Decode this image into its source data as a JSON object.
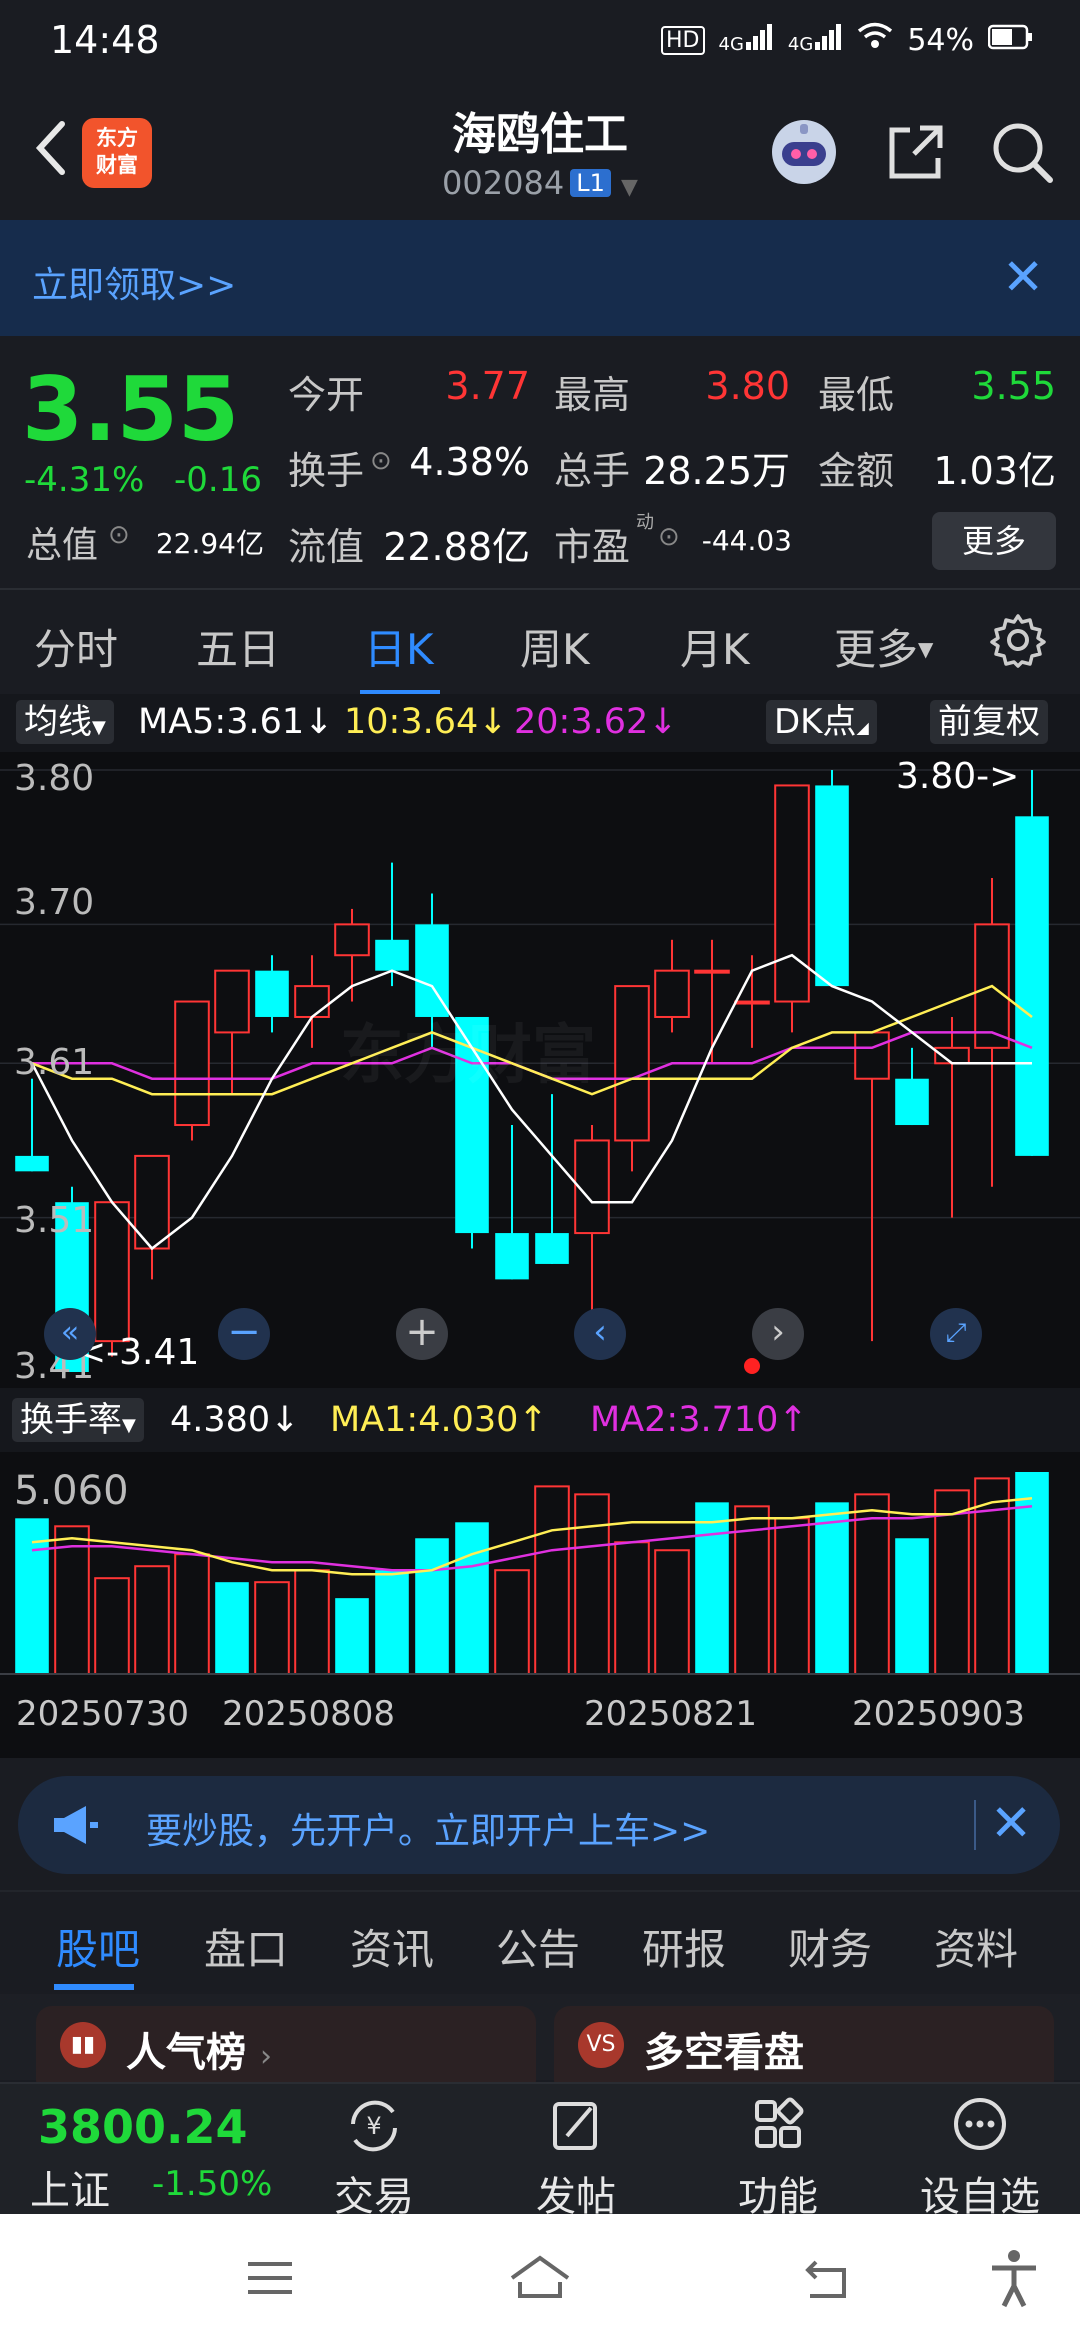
{
  "status": {
    "time": "14:48",
    "hd": "HD",
    "sig1": "4G",
    "sig2": "4G",
    "battery": "54%"
  },
  "header": {
    "logo_line1": "东方",
    "logo_line2": "财富",
    "stock_name": "海鸥住工",
    "stock_code": "002084",
    "level": "L1"
  },
  "banner": {
    "text": "立即领取>>"
  },
  "quote": {
    "price": "3.55",
    "change_pct": "-4.31%",
    "change": "-0.16",
    "open_label": "今开",
    "open": "3.77",
    "high_label": "最高",
    "high": "3.80",
    "low_label": "最低",
    "low": "3.55",
    "turnover_label": "换手",
    "turnover": "4.38%",
    "volume_label": "总手",
    "volume": "28.25万",
    "amount_label": "金额",
    "amount": "1.03亿",
    "mcap_label": "总值",
    "mcap": "22.94亿",
    "float_label": "流值",
    "float": "22.88亿",
    "pe_label": "市盈",
    "pe_tag": "动",
    "pe": "-44.03",
    "more": "更多"
  },
  "ktabs": [
    "分时",
    "五日",
    "日K",
    "周K",
    "月K",
    "更多"
  ],
  "indicators": {
    "ma_label": "均线",
    "ma5": "MA5:3.61↓",
    "ma10": "10:3.64↓",
    "ma20": "20:3.62↓",
    "dk": "DK点",
    "fq": "前复权"
  },
  "kchart": {
    "y_labels": [
      "3.80",
      "3.70",
      "3.61",
      "3.51",
      "3.41"
    ],
    "max_note": "3.80->",
    "min_note": "<-3.41",
    "watermark": "东方财富"
  },
  "vol": {
    "label": "换手率",
    "value": "4.380↓",
    "ma1": "MA1:4.030↑",
    "ma2": "MA2:3.710↑",
    "y_label": "5.060",
    "dates": [
      "20250730",
      "20250808",
      "20250821",
      "20250903"
    ]
  },
  "chart_data": {
    "type": "candlestick",
    "ylim": [
      3.41,
      3.8
    ],
    "candles": [
      {
        "o": 3.55,
        "h": 3.6,
        "l": 3.54,
        "c": 3.54
      },
      {
        "o": 3.52,
        "h": 3.53,
        "l": 3.41,
        "c": 3.41
      },
      {
        "o": 3.43,
        "h": 3.52,
        "l": 3.42,
        "c": 3.52
      },
      {
        "o": 3.49,
        "h": 3.55,
        "l": 3.47,
        "c": 3.55
      },
      {
        "o": 3.57,
        "h": 3.65,
        "l": 3.56,
        "c": 3.65
      },
      {
        "o": 3.63,
        "h": 3.67,
        "l": 3.59,
        "c": 3.67
      },
      {
        "o": 3.67,
        "h": 3.68,
        "l": 3.63,
        "c": 3.64
      },
      {
        "o": 3.64,
        "h": 3.68,
        "l": 3.62,
        "c": 3.66
      },
      {
        "o": 3.68,
        "h": 3.71,
        "l": 3.65,
        "c": 3.7
      },
      {
        "o": 3.69,
        "h": 3.74,
        "l": 3.66,
        "c": 3.67
      },
      {
        "o": 3.7,
        "h": 3.72,
        "l": 3.62,
        "c": 3.64
      },
      {
        "o": 3.64,
        "h": 3.64,
        "l": 3.49,
        "c": 3.5
      },
      {
        "o": 3.5,
        "h": 3.57,
        "l": 3.47,
        "c": 3.47
      },
      {
        "o": 3.5,
        "h": 3.59,
        "l": 3.48,
        "c": 3.48
      },
      {
        "o": 3.5,
        "h": 3.57,
        "l": 3.44,
        "c": 3.56
      },
      {
        "o": 3.56,
        "h": 3.66,
        "l": 3.54,
        "c": 3.66
      },
      {
        "o": 3.64,
        "h": 3.69,
        "l": 3.63,
        "c": 3.67
      },
      {
        "o": 3.67,
        "h": 3.69,
        "l": 3.61,
        "c": 3.67
      },
      {
        "o": 3.65,
        "h": 3.68,
        "l": 3.62,
        "c": 3.65
      },
      {
        "o": 3.65,
        "h": 3.79,
        "l": 3.63,
        "c": 3.79
      },
      {
        "o": 3.79,
        "h": 3.8,
        "l": 3.66,
        "c": 3.66
      },
      {
        "o": 3.6,
        "h": 3.62,
        "l": 3.43,
        "c": 3.63
      },
      {
        "o": 3.6,
        "h": 3.62,
        "l": 3.57,
        "c": 3.57
      },
      {
        "o": 3.61,
        "h": 3.64,
        "l": 3.51,
        "c": 3.62
      },
      {
        "o": 3.62,
        "h": 3.73,
        "l": 3.53,
        "c": 3.7
      },
      {
        "o": 3.77,
        "h": 3.8,
        "l": 3.55,
        "c": 3.55
      }
    ],
    "ma5": [
      3.61,
      3.56,
      3.52,
      3.49,
      3.51,
      3.55,
      3.6,
      3.64,
      3.66,
      3.67,
      3.66,
      3.62,
      3.58,
      3.55,
      3.52,
      3.52,
      3.56,
      3.62,
      3.67,
      3.68,
      3.66,
      3.65,
      3.63,
      3.61,
      3.61,
      3.61
    ],
    "ma10": [
      3.61,
      3.6,
      3.6,
      3.59,
      3.59,
      3.59,
      3.59,
      3.6,
      3.61,
      3.62,
      3.63,
      3.62,
      3.61,
      3.6,
      3.59,
      3.6,
      3.6,
      3.6,
      3.6,
      3.62,
      3.63,
      3.63,
      3.64,
      3.65,
      3.66,
      3.64
    ],
    "ma20": [
      3.61,
      3.61,
      3.61,
      3.6,
      3.6,
      3.6,
      3.6,
      3.61,
      3.61,
      3.61,
      3.62,
      3.61,
      3.61,
      3.6,
      3.6,
      3.6,
      3.61,
      3.61,
      3.61,
      3.62,
      3.62,
      3.62,
      3.63,
      3.63,
      3.63,
      3.62
    ],
    "volume": {
      "ylim": [
        0,
        5.06
      ],
      "values": [
        3.9,
        3.7,
        2.4,
        2.7,
        3.0,
        2.3,
        2.3,
        2.6,
        1.9,
        2.6,
        3.4,
        3.8,
        2.6,
        4.7,
        4.5,
        3.3,
        3.1,
        4.3,
        4.2,
        3.9,
        4.3,
        4.5,
        3.4,
        4.6,
        4.9,
        5.06
      ],
      "up": [
        0,
        1,
        1,
        1,
        1,
        0,
        1,
        1,
        0,
        0,
        0,
        0,
        1,
        1,
        1,
        1,
        1,
        0,
        1,
        1,
        0,
        1,
        0,
        1,
        1,
        0
      ],
      "ma1": [
        3.3,
        3.4,
        3.3,
        3.2,
        3.1,
        2.8,
        2.6,
        2.6,
        2.5,
        2.5,
        2.6,
        3.0,
        3.3,
        3.6,
        3.7,
        3.8,
        3.8,
        3.8,
        3.9,
        3.9,
        4.0,
        4.1,
        4.0,
        4.0,
        4.3,
        4.4
      ],
      "ma2": [
        3.1,
        3.2,
        3.2,
        3.1,
        3.0,
        2.9,
        2.8,
        2.8,
        2.7,
        2.6,
        2.6,
        2.7,
        2.9,
        3.1,
        3.2,
        3.3,
        3.4,
        3.5,
        3.6,
        3.7,
        3.8,
        3.9,
        3.9,
        4.0,
        4.1,
        4.2
      ]
    }
  },
  "ad": {
    "text": "要炒股，先开户。立即开户上车>>"
  },
  "btabs": [
    "股吧",
    "盘口",
    "资讯",
    "公告",
    "研报",
    "财务",
    "资料"
  ],
  "cards": {
    "card1": "人气榜",
    "card2": "多空看盘",
    "card2_icon": "VS"
  },
  "footer": {
    "index_value": "3800.24",
    "index_name": "上证",
    "index_change": "-1.50%",
    "items": [
      "交易",
      "发帖",
      "功能",
      "设自选"
    ],
    "trade_icon": "¥"
  },
  "colors": {
    "up": "#ff3535",
    "down": "#1fd93a",
    "bar_down": "#00ffff",
    "ma5": "#ffffff",
    "ma10": "#ffee55",
    "ma20": "#e030e0",
    "accent": "#2f8bff"
  }
}
